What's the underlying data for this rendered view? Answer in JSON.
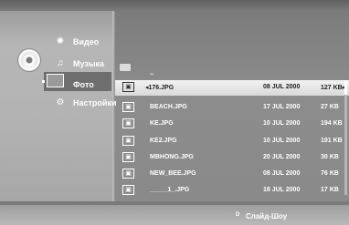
{
  "disc": {
    "label": "CD",
    "icon": "cd-disc-icon"
  },
  "menu": {
    "items": [
      {
        "label": "Видео",
        "icon": "film-reel-icon"
      },
      {
        "label": "Музыка",
        "icon": "music-note-icon"
      },
      {
        "label": "Фото",
        "icon": "photo-icon",
        "selected": true
      },
      {
        "label": "Настройки",
        "icon": "gear-icon"
      }
    ]
  },
  "list": {
    "parent": {
      "label": "..",
      "icon": "folder-icon"
    },
    "rows": [
      {
        "name": "176.JPG",
        "date": "08 JUL 2000",
        "size": "127 KB",
        "selected": true
      },
      {
        "name": "BEACH.JPG",
        "date": "17 JUL 2000",
        "size": "27 KB"
      },
      {
        "name": "KE.JPG",
        "date": "10 JUL 2000",
        "size": "194 KB"
      },
      {
        "name": "KE2.JPG",
        "date": "10 JUL 2000",
        "size": "191 KB"
      },
      {
        "name": "MBHONG.JPG",
        "date": "20 JUL 2000",
        "size": "30 KB"
      },
      {
        "name": "NEW_BEE.JPG",
        "date": "08 JUL 2000",
        "size": "76 KB"
      },
      {
        "name": "_____1_.JPG",
        "date": "18 JUL 2000",
        "size": "17 KB"
      }
    ]
  },
  "footer": {
    "key": "D",
    "label": "Слайд-Шоу"
  },
  "colors": {
    "highlight": "#e6e6e6",
    "panel": "#8c8c8c",
    "menu": "#b2b2b2"
  }
}
